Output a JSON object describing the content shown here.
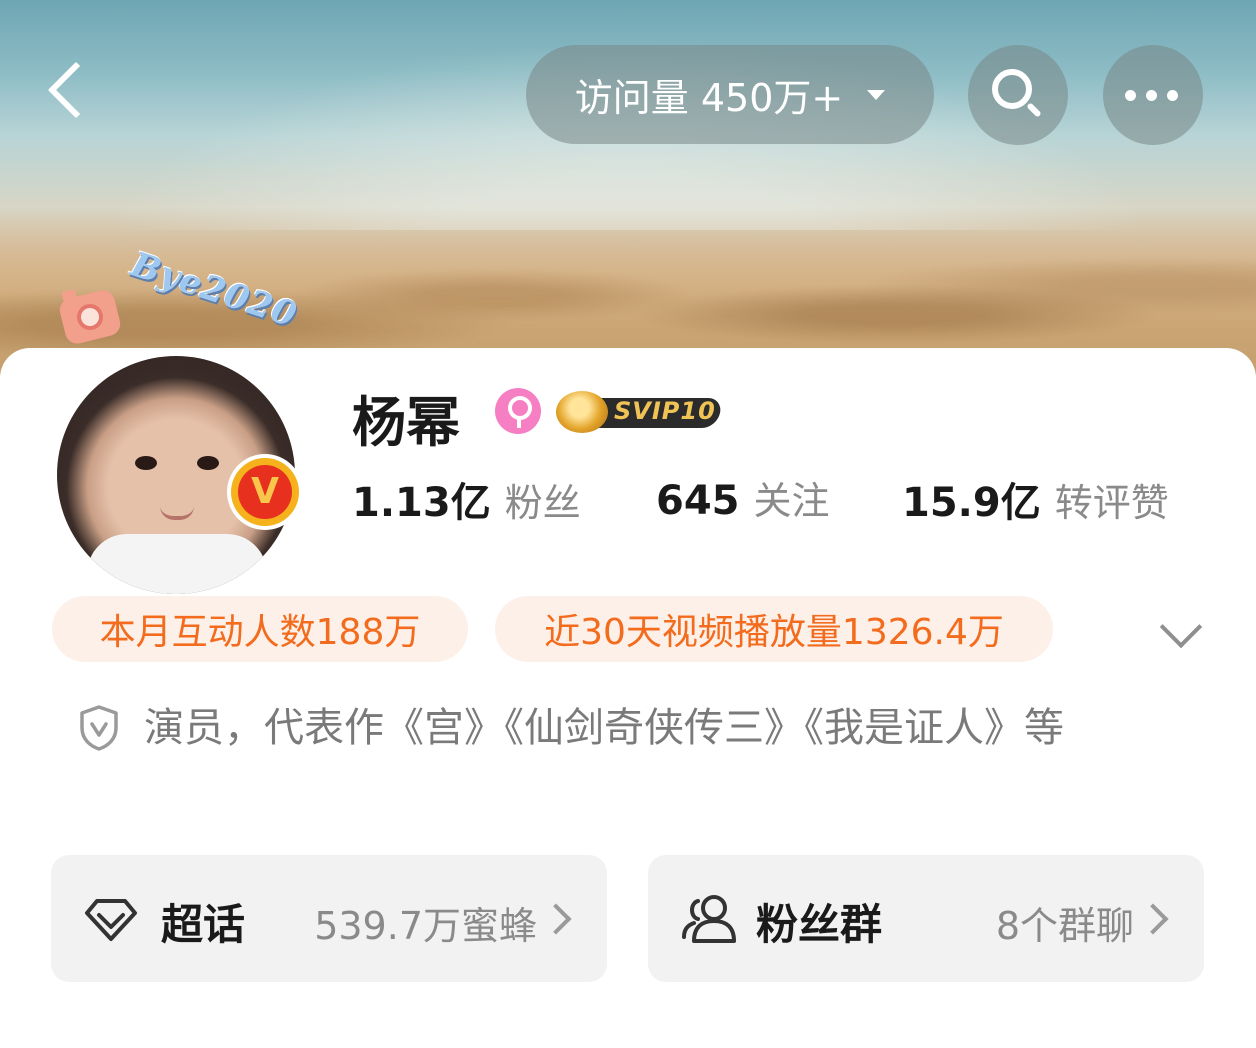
{
  "header": {
    "visits_label": "访问量 450万+"
  },
  "avatar": {
    "decoration_text": "Bye2020"
  },
  "profile": {
    "name": "杨幂",
    "svip_label": "SVIP10",
    "stats": [
      {
        "value": "1.13亿",
        "label": "粉丝"
      },
      {
        "value": "645",
        "label": "关注"
      },
      {
        "value": "15.9亿",
        "label": "转评赞"
      }
    ]
  },
  "pills": [
    "本月互动人数188万",
    "近30天视频播放量1326.4万"
  ],
  "bio": {
    "text": "演员，代表作《宫》《仙剑奇侠传三》《我是证人》等"
  },
  "tiles": [
    {
      "title": "超话",
      "meta": "539.7万蜜蜂"
    },
    {
      "title": "粉丝群",
      "meta": "8个群聊"
    }
  ],
  "colors": {
    "accent_orange": "#f36b1c",
    "pill_bg": "#fdf0e8",
    "gender_pink": "#f57fc2",
    "verified_red": "#e7311e"
  },
  "icons": {
    "back": "chevron-left-icon",
    "search": "search-icon",
    "more": "more-icon",
    "gender": "female-icon",
    "verified": "verified-v-icon",
    "expand": "chevron-down-icon",
    "bio": "shield-v-icon",
    "supertopic": "diamond-icon",
    "fangroup": "group-icon"
  }
}
